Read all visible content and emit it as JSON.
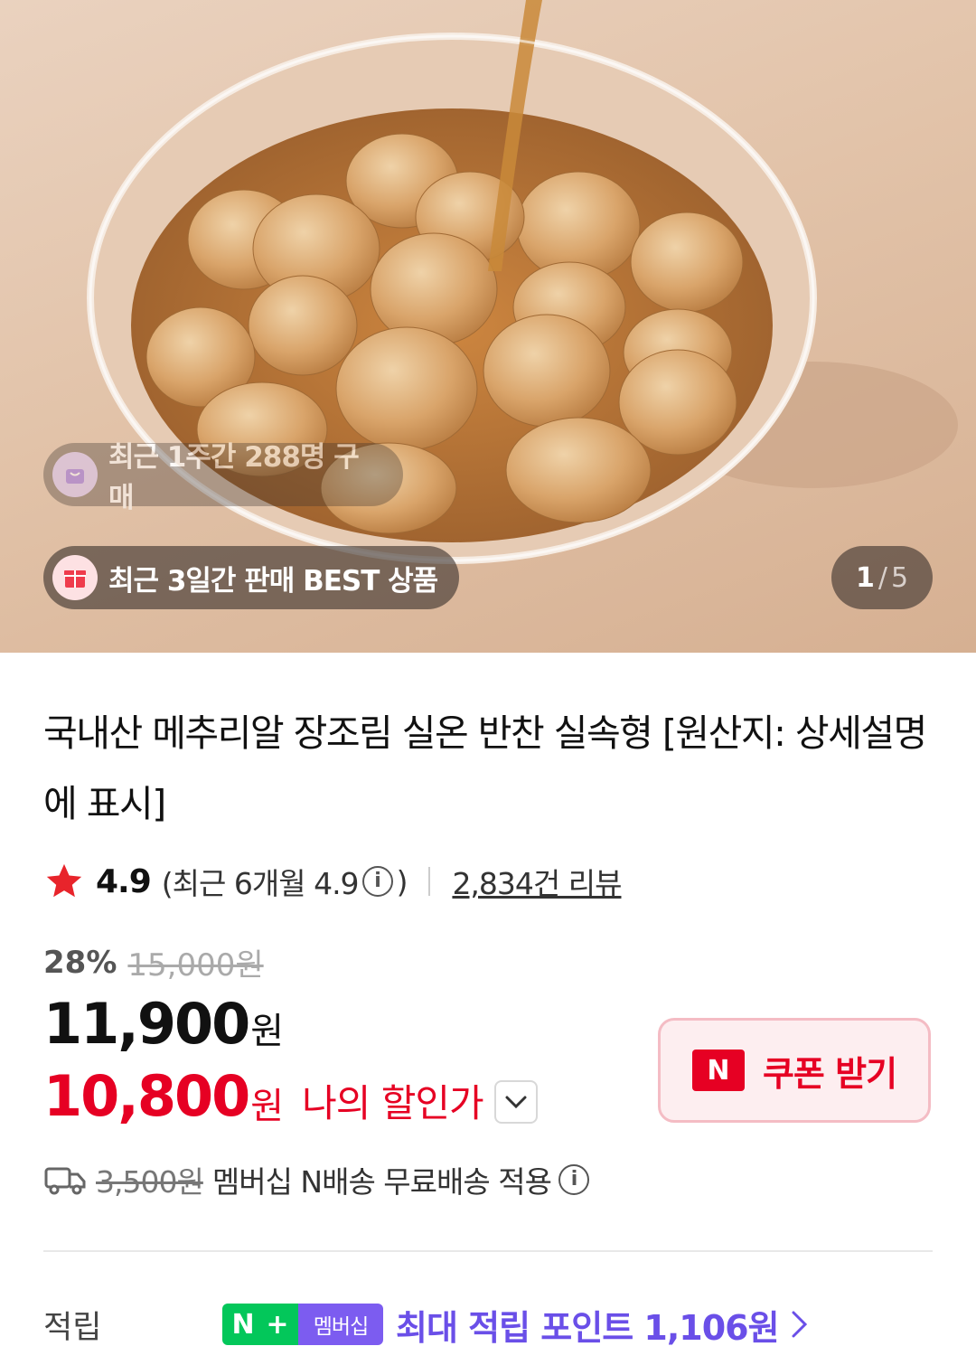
{
  "hero": {
    "recent_week_text": "최근 1주간 288명 구매",
    "best_text": "최근 3일간 판매 BEST 상품",
    "image_index": "1",
    "image_sep": "/",
    "image_total": "5"
  },
  "product": {
    "title": "국내산 메추리알 장조림 실온 반찬 실속형 [원산지: 상세설명에 표시]",
    "rating": "4.9",
    "recent_rating_prefix": "(최근 6개월 4.9",
    "recent_rating_suffix": ")",
    "review_count": "2,834건 리뷰",
    "discount_pct": "28%",
    "original_price": "15,000원",
    "price_amount": "11,900",
    "price_unit": "원",
    "my_price_amount": "10,800",
    "my_price_unit": "원",
    "my_price_label": "나의 할인가"
  },
  "coupon": {
    "logo": "N",
    "label": "쿠폰 받기"
  },
  "shipping": {
    "fee": "3,500원",
    "text": "멤버십 N배송 무료배송 적용"
  },
  "points": {
    "label": "적립",
    "badge_n": "N",
    "badge_plus": "+",
    "badge_membership": "멤버십",
    "text": "최대 적립 포인트 1,106원"
  },
  "colors": {
    "accent_red": "#e60023",
    "naver_green": "#03c75a",
    "membership_purple": "#7c5cf0"
  }
}
